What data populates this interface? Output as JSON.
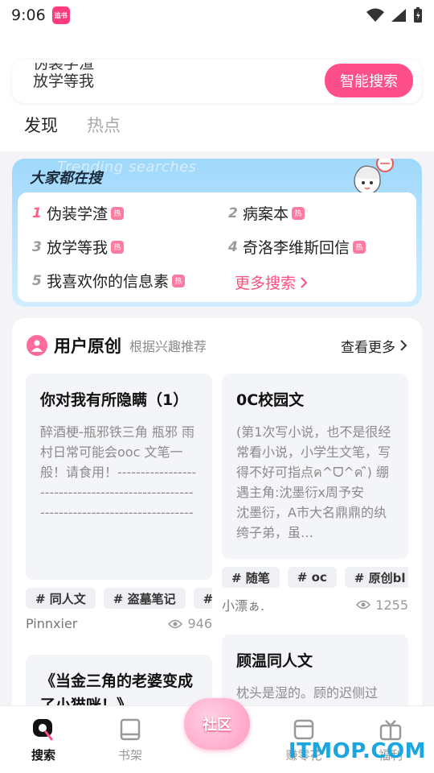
{
  "status_bar": {
    "time": "9:06",
    "app_badge": "追书"
  },
  "search": {
    "rotating_hints": [
      "伪装学渣",
      "放学等我"
    ],
    "button_label": "智能搜索"
  },
  "tabs": [
    {
      "label": "发现",
      "active": true
    },
    {
      "label": "热点",
      "active": false
    }
  ],
  "trending": {
    "bg_text": "Trending searches",
    "title": "大家都在搜",
    "hot_badge": "热",
    "items": [
      {
        "rank": "1",
        "title": "伪装学渣"
      },
      {
        "rank": "2",
        "title": "病案本"
      },
      {
        "rank": "3",
        "title": "放学等我"
      },
      {
        "rank": "4",
        "title": "奇洛李维斯回信"
      },
      {
        "rank": "5",
        "title": "我喜欢你的信息素"
      }
    ],
    "more_label": "更多搜索"
  },
  "original": {
    "title": "用户原创",
    "subtitle": "根据兴趣推荐",
    "more_label": "查看更多",
    "books": [
      {
        "title": "你对我有所隐瞒（1）",
        "desc": "醉酒梗-瓶邪铁三角 瓶邪 雨村日常可能会ooc 文笔一般！请食用！--------------------------------------------------------------------------------------正值酷…",
        "tags": [
          "# 同人文",
          "# 盗墓笔记",
          "# 瓶"
        ],
        "author": "Pinnxier",
        "views": "946"
      },
      {
        "title": "0C校园文",
        "desc": "(第1次写小说，也不是很经常看小说，小学生文笔，写得不好可指点ค^ᗜ^ค ̑̑) 绷遇主角:沈墨衍x周予安　　沈墨衍，A市大名鼎鼎的纨绔子弟，虽…",
        "tags": [
          "# 随笔",
          "# oc",
          "# 原创bl"
        ],
        "author": "小漂ぁ.",
        "views": "1255"
      },
      {
        "title": "《当金三角的老婆变成了小猫咪！》",
        "desc": "",
        "tags": [],
        "author": "",
        "views": ""
      },
      {
        "title": "顾温同人文",
        "desc": "枕头是湿的。顾的迟侧过",
        "tags": [],
        "author": "",
        "views": ""
      }
    ]
  },
  "bottom_nav": {
    "items": [
      {
        "label": "搜索",
        "icon": "search-icon",
        "active": true
      },
      {
        "label": "书架",
        "icon": "bookshelf-icon",
        "active": false
      },
      {
        "label": "社区",
        "icon": "community-icon",
        "active": false
      },
      {
        "label": "赚零花",
        "icon": "wallet-icon",
        "active": false
      },
      {
        "label": "福利",
        "icon": "gift-icon",
        "active": false
      }
    ]
  },
  "watermark": "ITMOP.COM",
  "colors": {
    "accent": "#ff4f8b",
    "trend_bg": "#9fd8fb",
    "hot": "#ff5f86"
  }
}
